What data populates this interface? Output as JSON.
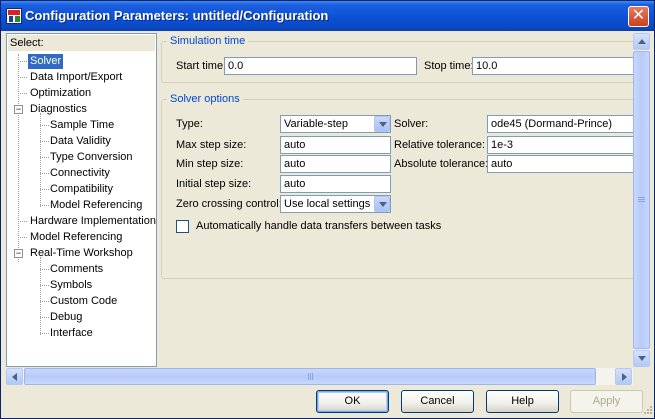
{
  "window": {
    "title": "Configuration Parameters: untitled/Configuration",
    "close_glyph": "✕",
    "icon": "simulink-app-icon"
  },
  "tree": {
    "header": "Select:",
    "items": [
      {
        "label": "Solver",
        "selected": true
      },
      {
        "label": "Data Import/Export"
      },
      {
        "label": "Optimization"
      },
      {
        "label": "Diagnostics",
        "expander": "−"
      },
      {
        "label": "Sample Time"
      },
      {
        "label": "Data Validity"
      },
      {
        "label": "Type Conversion"
      },
      {
        "label": "Connectivity"
      },
      {
        "label": "Compatibility"
      },
      {
        "label": "Model Referencing"
      },
      {
        "label": "Hardware Implementation"
      },
      {
        "label": "Model Referencing"
      },
      {
        "label": "Real-Time Workshop",
        "expander": "−"
      },
      {
        "label": "Comments"
      },
      {
        "label": "Symbols"
      },
      {
        "label": "Custom Code"
      },
      {
        "label": "Debug"
      },
      {
        "label": "Interface"
      }
    ]
  },
  "simulation_time": {
    "title": "Simulation time",
    "start_label": "Start time:",
    "start_value": "0.0",
    "stop_label": "Stop time:",
    "stop_value": "10.0"
  },
  "solver_options": {
    "title": "Solver options",
    "type_label": "Type:",
    "type_value": "Variable-step",
    "solver_label": "Solver:",
    "solver_value": "ode45 (Dormand-Prince)",
    "max_step_label": "Max step size:",
    "max_step_value": "auto",
    "rel_tol_label": "Relative tolerance:",
    "rel_tol_value": "1e-3",
    "min_step_label": "Min step size:",
    "min_step_value": "auto",
    "abs_tol_label": "Absolute tolerance:",
    "abs_tol_value": "auto",
    "init_step_label": "Initial step size:",
    "init_step_value": "auto",
    "zero_cross_label": "Zero crossing control:",
    "zero_cross_value": "Use local settings",
    "auto_transfer_label": "Automatically handle data transfers between tasks",
    "auto_transfer_checked": false
  },
  "buttons": {
    "ok": "OK",
    "cancel": "Cancel",
    "help": "Help",
    "apply": "Apply"
  },
  "colors": {
    "titlebar": "#0a49c8",
    "group_title": "#0046d5",
    "selection": "#316ac5",
    "dialog_bg": "#ece9d8"
  }
}
